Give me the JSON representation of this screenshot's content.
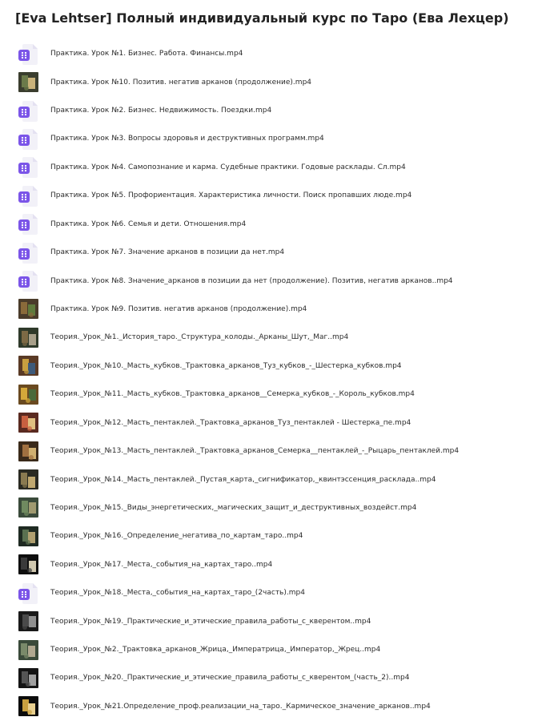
{
  "folder": {
    "title": "[Eva Lehtser] Полный индивидуальный курс по Таро (Ева Лехцер)"
  },
  "files": [
    {
      "name": "Практика. Урок №1. Бизнес. Работа. Финансы.mp4",
      "icon": "video-file-icon",
      "thumb": null
    },
    {
      "name": "Практика. Урок №10. Позитив. негатив арканов (продолжение).mp4",
      "icon": "video-thumbnail",
      "thumb": {
        "bg": "#3a3d2e",
        "a": "#6b7a4a",
        "b": "#c9b27a"
      }
    },
    {
      "name": "Практика. Урок №2. Бизнес. Недвижимость. Поездки.mp4",
      "icon": "video-file-icon",
      "thumb": null
    },
    {
      "name": "Практика. Урок №3. Вопросы здоровья и деструктивных программ.mp4",
      "icon": "video-file-icon",
      "thumb": null
    },
    {
      "name": "Практика. Урок №4. Самопознание и карма. Судебные практики. Годовые расклады. Сл.mp4",
      "icon": "video-file-icon",
      "thumb": null
    },
    {
      "name": "Практика. Урок №5. Профориентация. Характеристика личности. Поиск пропавших люде.mp4",
      "icon": "video-file-icon",
      "thumb": null
    },
    {
      "name": "Практика. Урок №6. Семья и дети. Отношения.mp4",
      "icon": "video-file-icon",
      "thumb": null
    },
    {
      "name": "Практика. Урок №7. Значение арканов в позиции да нет.mp4",
      "icon": "video-file-icon",
      "thumb": null
    },
    {
      "name": "Практика. Урок №8. Значение_арканов в позиции да нет (продолжение). Позитив, негатив арканов..mp4",
      "icon": "video-file-icon",
      "thumb": null
    },
    {
      "name": "Практика. Урок №9. Позитив. негатив арканов (продолжение).mp4",
      "icon": "video-thumbnail",
      "thumb": {
        "bg": "#4a3b2a",
        "a": "#8a6a3a",
        "b": "#5f7a3c"
      }
    },
    {
      "name": "Теория._Урок_№1._История_таро._Структура_колоды._Арканы_Шут,_Маг..mp4",
      "icon": "video-thumbnail",
      "thumb": {
        "bg": "#2f3a2a",
        "a": "#7d6a45",
        "b": "#a8a08a"
      }
    },
    {
      "name": "Теория._Урок_№10._Масть_кубков._Трактовка_арканов_Туз_кубков_-_Шестерка_кубков.mp4",
      "icon": "video-thumbnail",
      "thumb": {
        "bg": "#5a3a25",
        "a": "#c8a040",
        "b": "#3d5a7a"
      }
    },
    {
      "name": "Теория._Урок_№11._Масть_кубков._Трактовка_арканов__Семерка_кубков_-_Король_кубков.mp4",
      "icon": "video-thumbnail",
      "thumb": {
        "bg": "#6a4a20",
        "a": "#d4a83a",
        "b": "#4a6a3a"
      }
    },
    {
      "name": "Теория._Урок_№12._Масть_пентаклей._Трактовка_арканов_Туз_пентаклей - Шестерка_пе.mp4",
      "icon": "video-thumbnail",
      "thumb": {
        "bg": "#5a2a20",
        "a": "#c86040",
        "b": "#e0c080"
      }
    },
    {
      "name": "Теория._Урок_№13._Масть_пентаклей._Трактовка_арканов_Семерка__пентаклей_-_Рыцарь_пентаклей.mp4",
      "icon": "video-thumbnail",
      "thumb": {
        "bg": "#3a2a1a",
        "a": "#a07040",
        "b": "#d0b070"
      }
    },
    {
      "name": "Теория._Урок_№14._Масть_пентаклей._Пустая_карта,_сигнификатор,_квинтэссенция_расклада..mp4",
      "icon": "video-thumbnail",
      "thumb": {
        "bg": "#2a2a22",
        "a": "#8a7a50",
        "b": "#c0a870"
      }
    },
    {
      "name": "Теория._Урок_№15._Виды_энергетических,_магических_защит_и_деструктивных_воздейст.mp4",
      "icon": "video-thumbnail",
      "thumb": {
        "bg": "#3a4a3a",
        "a": "#708a60",
        "b": "#a09a70"
      }
    },
    {
      "name": "Теория._Урок_№16._Определение_негатива_по_картам_таро..mp4",
      "icon": "video-thumbnail",
      "thumb": {
        "bg": "#1f2a22",
        "a": "#5a7050",
        "b": "#b0a070"
      }
    },
    {
      "name": "Теория._Урок_№17._Места,_события_на_картах_таро..mp4",
      "icon": "video-thumbnail",
      "thumb": {
        "bg": "#0e0e0e",
        "a": "#3a3a3a",
        "b": "#d0c8b0"
      }
    },
    {
      "name": "Теория._Урок_№18._Места,_события_на_картах_таро_(2часть).mp4",
      "icon": "video-file-icon",
      "thumb": null
    },
    {
      "name": "Теория._Урок_№19._Практические_и_этические_правила_работы_с_кверентом..mp4",
      "icon": "video-thumbnail",
      "thumb": {
        "bg": "#1a1a1a",
        "a": "#4a4a4a",
        "b": "#909090"
      }
    },
    {
      "name": "Теория._Урок_№2._Трактовка_арканов_Жрица,_Императрица,_Император,_Жрец..mp4",
      "icon": "video-thumbnail",
      "thumb": {
        "bg": "#3a4a3a",
        "a": "#7a8a6a",
        "b": "#b0a890"
      }
    },
    {
      "name": "Теория._Урок_№20._Практические_и_этические_правила_работы_с_кверентом_(часть_2)..mp4",
      "icon": "video-thumbnail",
      "thumb": {
        "bg": "#151515",
        "a": "#555555",
        "b": "#a0a0a0"
      }
    },
    {
      "name": "Теория._Урок_№21.Определение_проф.реализации_на_таро._Кармическое_значение_арканов..mp4",
      "icon": "video-thumbnail",
      "thumb": {
        "bg": "#0c0c0c",
        "a": "#c8a040",
        "b": "#e8d090"
      }
    }
  ]
}
